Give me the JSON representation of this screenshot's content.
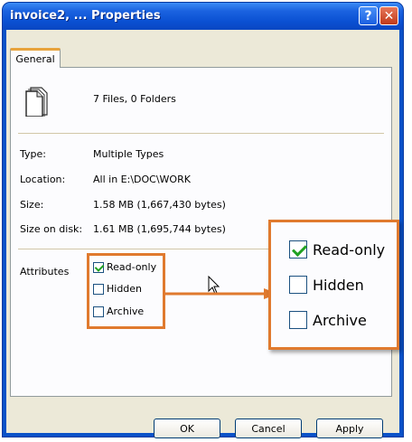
{
  "window": {
    "title": "invoice2, ... Properties",
    "help_label": "?",
    "close_label": "✕"
  },
  "tabs": [
    {
      "label": "General",
      "active": true
    }
  ],
  "general": {
    "icon": "file-stack-icon",
    "summary": "7 Files, 0 Folders",
    "rows": [
      {
        "label": "Type:",
        "value": "Multiple Types"
      },
      {
        "label": "Location:",
        "value": "All in E:\\DOC\\WORK"
      },
      {
        "label": "Size:",
        "value": "1.58 MB (1,667,430 bytes)"
      },
      {
        "label": "Size on disk:",
        "value": "1.61 MB (1,695,744 bytes)"
      }
    ],
    "attributes": {
      "label": "Attributes",
      "items": [
        {
          "label": "Read-only",
          "checked": true
        },
        {
          "label": "Hidden",
          "checked": false
        },
        {
          "label": "Archive",
          "checked": false
        }
      ]
    }
  },
  "zoom_callout": {
    "items": [
      {
        "label": "Read-only",
        "checked": true
      },
      {
        "label": "Hidden",
        "checked": false
      },
      {
        "label": "Archive",
        "checked": false
      }
    ]
  },
  "buttons": {
    "ok": "OK",
    "cancel": "Cancel",
    "apply": "Apply"
  },
  "colors": {
    "highlight": "#e07a2e",
    "title_bar": "#0a50d2"
  }
}
